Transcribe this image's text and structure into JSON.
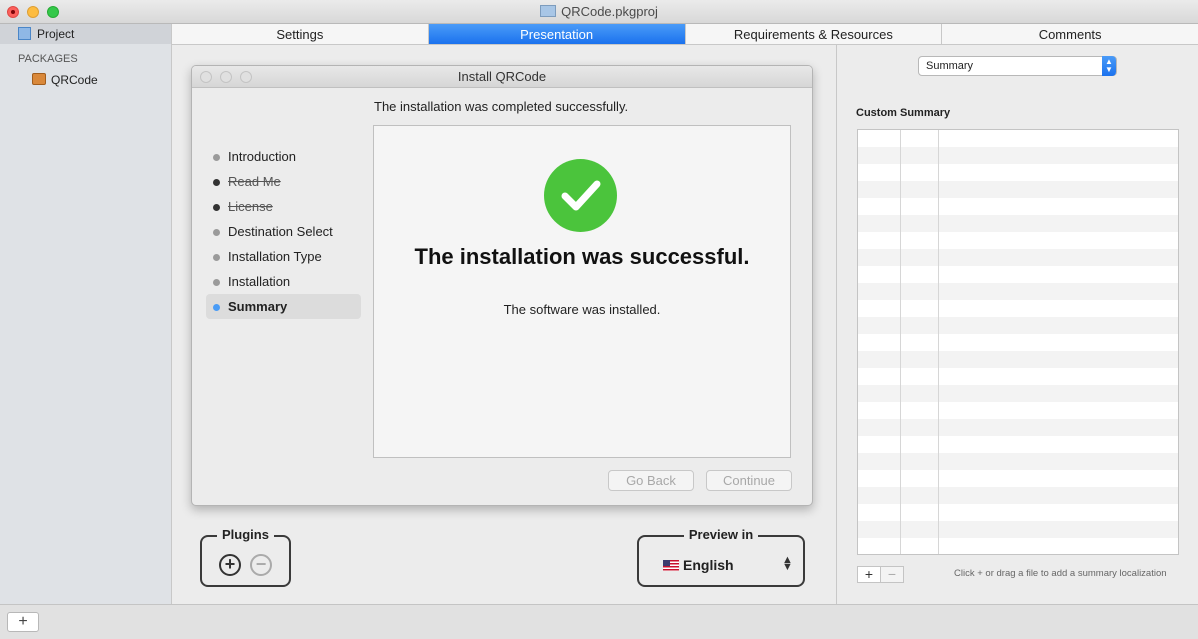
{
  "window": {
    "title": "QRCode.pkgproj"
  },
  "sidebar": {
    "project_label": "Project",
    "section_label": "PACKAGES",
    "package_label": "QRCode"
  },
  "tabs": [
    {
      "label": "Settings"
    },
    {
      "label": "Presentation",
      "active": true
    },
    {
      "label": "Requirements & Resources"
    },
    {
      "label": "Comments"
    }
  ],
  "installer": {
    "title": "Install QRCode",
    "header": "The installation was completed successfully.",
    "steps": [
      {
        "label": "Introduction",
        "state": "normal"
      },
      {
        "label": "Read Me",
        "state": "disabled"
      },
      {
        "label": "License",
        "state": "disabled"
      },
      {
        "label": "Destination Select",
        "state": "normal"
      },
      {
        "label": "Installation Type",
        "state": "normal"
      },
      {
        "label": "Installation",
        "state": "normal"
      },
      {
        "label": "Summary",
        "state": "active"
      }
    ],
    "success_title": "The installation was successful.",
    "success_sub": "The software was installed.",
    "back_label": "Go Back",
    "continue_label": "Continue"
  },
  "plugins": {
    "label": "Plugins"
  },
  "preview": {
    "label": "Preview in",
    "language": "English"
  },
  "right_panel": {
    "popup_value": "Summary",
    "section_label": "Custom Summary",
    "hint": "Click + or drag a file to add a summary localization"
  },
  "bottom": {
    "add_label": "+"
  },
  "colors": {
    "accent": "#1b72ee",
    "success": "#4bc43c"
  }
}
